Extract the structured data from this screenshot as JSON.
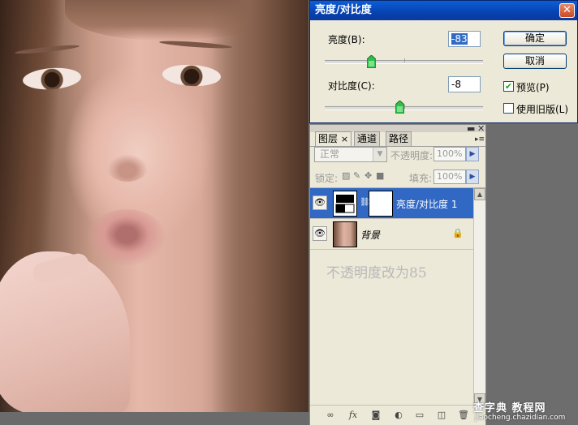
{
  "dialog": {
    "title": "亮度/对比度",
    "brightness_label": "亮度(B):",
    "brightness_value": "-83",
    "contrast_label": "对比度(C):",
    "contrast_value": "-8",
    "ok_label": "确定",
    "cancel_label": "取消",
    "preview_label": "预览(P)",
    "preview_checked": true,
    "legacy_label": "使用旧版(L)",
    "legacy_checked": false,
    "brightness_slider_fraction": 0.29,
    "contrast_slider_fraction": 0.47
  },
  "layers_panel": {
    "tabs": [
      {
        "label": "图层",
        "active": true
      },
      {
        "label": "通道",
        "active": false
      },
      {
        "label": "路径",
        "active": false
      }
    ],
    "tab_close_glyph": "×",
    "blend_mode": "正常",
    "opacity_label": "不透明度:",
    "opacity_value": "100%",
    "lock_label": "锁定:",
    "fill_label": "填充:",
    "fill_value": "100%",
    "layers": [
      {
        "name": "亮度/对比度 1",
        "selected": true,
        "visible": true
      },
      {
        "name": "背景",
        "selected": false,
        "visible": true,
        "locked": true
      }
    ],
    "annotation": "不透明度改为85"
  },
  "watermark": {
    "line1": "查字典 教程网",
    "line2": "jiaocheng.chazidian.com"
  },
  "colors": {
    "titlebar": "#0a5fd8",
    "selected_layer": "#3168c4",
    "panel_bg": "#ece9d8"
  }
}
